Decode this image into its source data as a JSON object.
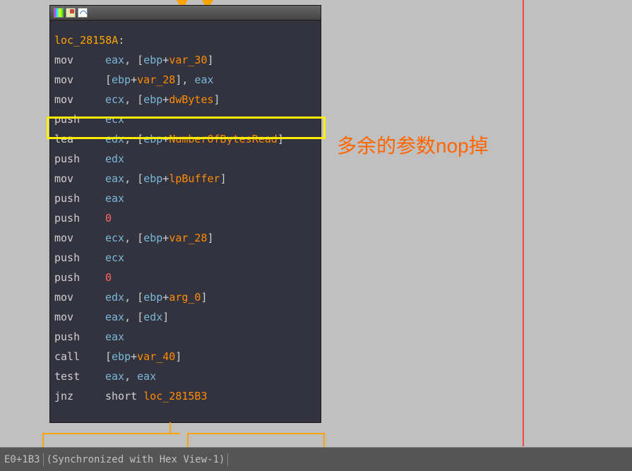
{
  "label_line": "loc_28158A:",
  "lines": [
    {
      "m": "mov",
      "ops": [
        [
          "reg",
          "eax"
        ],
        [
          "punct",
          ", ["
        ],
        [
          "reg",
          "ebp"
        ],
        [
          "punct",
          "+"
        ],
        [
          "var",
          "var_30"
        ],
        [
          "punct",
          "]"
        ]
      ]
    },
    {
      "m": "mov",
      "ops": [
        [
          "punct",
          "["
        ],
        [
          "reg",
          "ebp"
        ],
        [
          "punct",
          "+"
        ],
        [
          "var",
          "var_28"
        ],
        [
          "punct",
          "], "
        ],
        [
          "reg",
          "eax"
        ]
      ]
    },
    {
      "m": "mov",
      "ops": [
        [
          "reg",
          "ecx"
        ],
        [
          "punct",
          ", ["
        ],
        [
          "reg",
          "ebp"
        ],
        [
          "punct",
          "+"
        ],
        [
          "var",
          "dwBytes"
        ],
        [
          "punct",
          "]"
        ]
      ]
    },
    {
      "m": "push",
      "ops": [
        [
          "reg",
          "ecx"
        ]
      ]
    },
    {
      "m": "lea",
      "ops": [
        [
          "reg",
          "edx"
        ],
        [
          "punct",
          ", ["
        ],
        [
          "reg",
          "ebp"
        ],
        [
          "punct",
          "+"
        ],
        [
          "var",
          "NumberOfBytesRead"
        ],
        [
          "punct",
          "]"
        ]
      ]
    },
    {
      "m": "push",
      "ops": [
        [
          "reg",
          "edx"
        ]
      ]
    },
    {
      "m": "mov",
      "ops": [
        [
          "reg",
          "eax"
        ],
        [
          "punct",
          ", ["
        ],
        [
          "reg",
          "ebp"
        ],
        [
          "punct",
          "+"
        ],
        [
          "var",
          "lpBuffer"
        ],
        [
          "punct",
          "]"
        ]
      ]
    },
    {
      "m": "push",
      "ops": [
        [
          "reg",
          "eax"
        ]
      ]
    },
    {
      "m": "push",
      "ops": [
        [
          "num",
          "0"
        ]
      ]
    },
    {
      "m": "mov",
      "ops": [
        [
          "reg",
          "ecx"
        ],
        [
          "punct",
          ", ["
        ],
        [
          "reg",
          "ebp"
        ],
        [
          "punct",
          "+"
        ],
        [
          "var",
          "var_28"
        ],
        [
          "punct",
          "]"
        ]
      ]
    },
    {
      "m": "push",
      "ops": [
        [
          "reg",
          "ecx"
        ]
      ]
    },
    {
      "m": "push",
      "ops": [
        [
          "num",
          "0"
        ]
      ]
    },
    {
      "m": "mov",
      "ops": [
        [
          "reg",
          "edx"
        ],
        [
          "punct",
          ", ["
        ],
        [
          "reg",
          "ebp"
        ],
        [
          "punct",
          "+"
        ],
        [
          "var",
          "arg_0"
        ],
        [
          "punct",
          "]"
        ]
      ]
    },
    {
      "m": "mov",
      "ops": [
        [
          "reg",
          "eax"
        ],
        [
          "punct",
          ", ["
        ],
        [
          "reg",
          "edx"
        ],
        [
          "punct",
          "]"
        ]
      ]
    },
    {
      "m": "push",
      "ops": [
        [
          "reg",
          "eax"
        ]
      ]
    },
    {
      "m": "call",
      "ops": [
        [
          "punct",
          "["
        ],
        [
          "reg",
          "ebp"
        ],
        [
          "punct",
          "+"
        ],
        [
          "var",
          "var_40"
        ],
        [
          "punct",
          "]"
        ]
      ]
    },
    {
      "m": "test",
      "ops": [
        [
          "reg",
          "eax"
        ],
        [
          "punct",
          ", "
        ],
        [
          "reg",
          "eax"
        ]
      ]
    },
    {
      "m": "jnz",
      "ops": [
        [
          "punct",
          "short "
        ],
        [
          "var",
          "loc_2815B3"
        ]
      ]
    }
  ],
  "annotation": "多余的参数nop掉",
  "status": {
    "offset": "E0+1B3",
    "sync": "(Synchronized with Hex View-1)"
  }
}
